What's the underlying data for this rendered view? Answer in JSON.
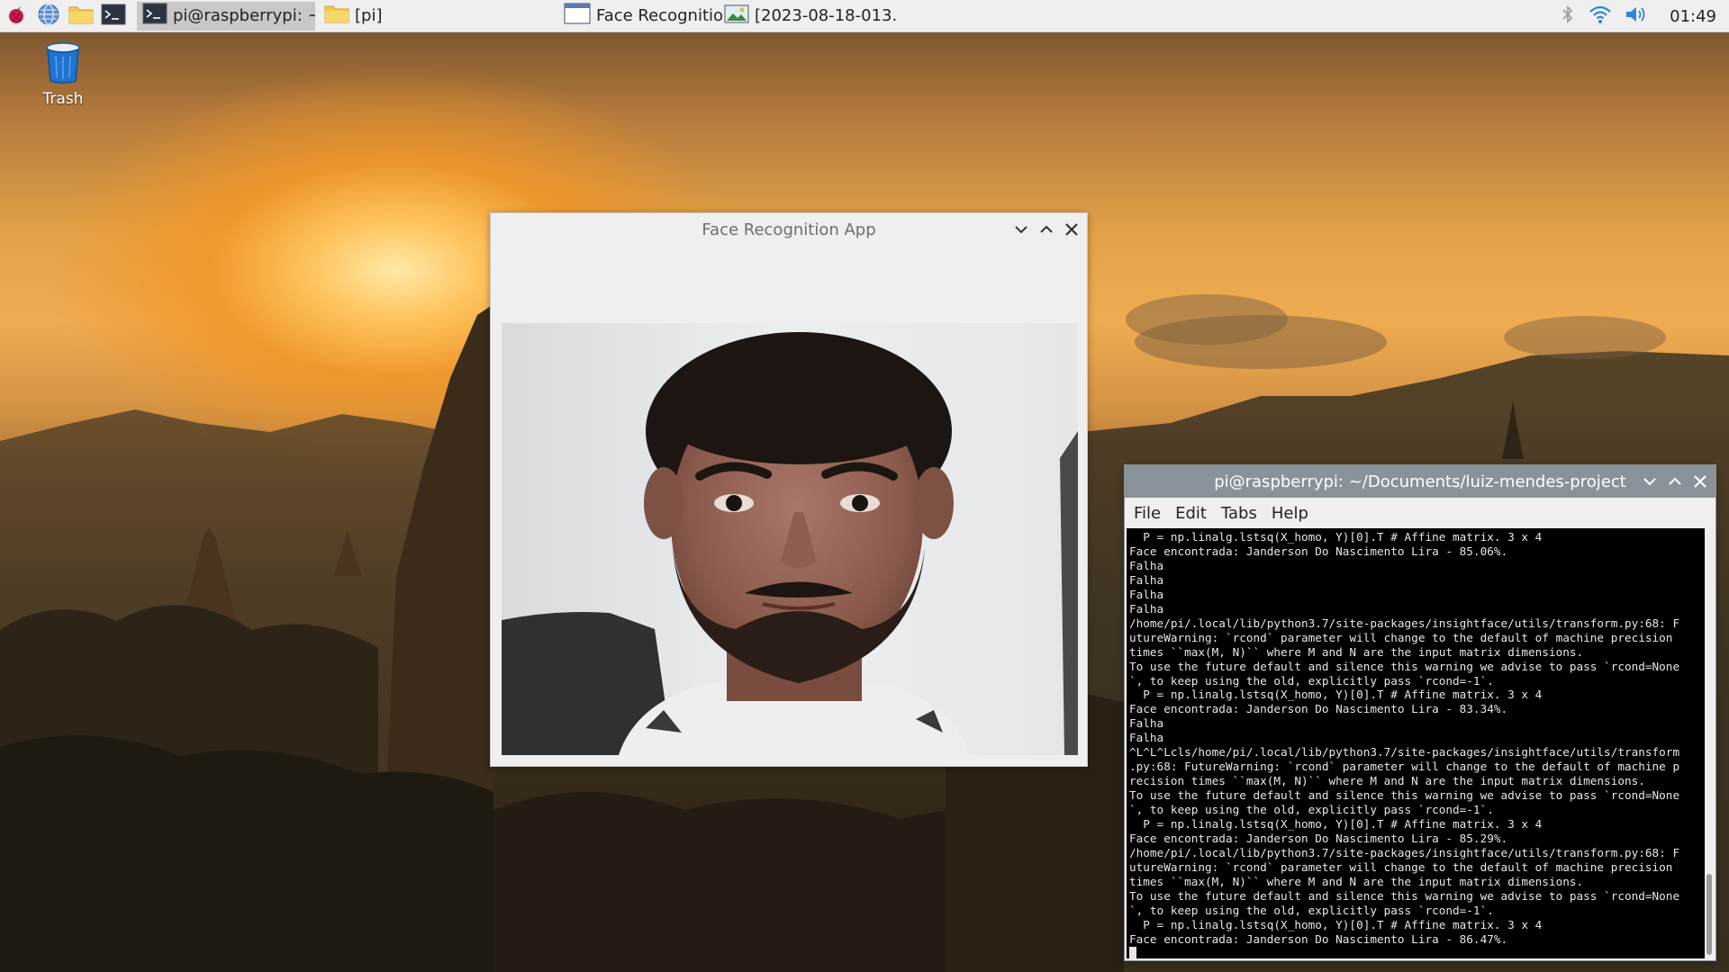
{
  "taskbar": {
    "tasks": [
      {
        "label": "pi@raspberrypi: ~..."
      },
      {
        "label": "[pi]"
      },
      {
        "label": "Face Recognition..."
      },
      {
        "label": "[2023-08-18-013..."
      }
    ],
    "clock": "01:49"
  },
  "desktop": {
    "trash_label": "Trash"
  },
  "face_window": {
    "title": "Face Recognition App"
  },
  "terminal": {
    "title": "pi@raspberrypi: ~/Documents/luiz-mendes-project",
    "menu": [
      "File",
      "Edit",
      "Tabs",
      "Help"
    ],
    "lines": [
      "  P = np.linalg.lstsq(X_homo, Y)[0].T # Affine matrix. 3 x 4",
      "Face encontrada: Janderson Do Nascimento Lira - 85.06%.",
      "Falha",
      "Falha",
      "Falha",
      "Falha",
      "/home/pi/.local/lib/python3.7/site-packages/insightface/utils/transform.py:68: F",
      "utureWarning: `rcond` parameter will change to the default of machine precision",
      "times ``max(M, N)`` where M and N are the input matrix dimensions.",
      "To use the future default and silence this warning we advise to pass `rcond=None",
      "`, to keep using the old, explicitly pass `rcond=-1`.",
      "  P = np.linalg.lstsq(X_homo, Y)[0].T # Affine matrix. 3 x 4",
      "Face encontrada: Janderson Do Nascimento Lira - 83.34%.",
      "Falha",
      "Falha",
      "^L^L^Lcls/home/pi/.local/lib/python3.7/site-packages/insightface/utils/transform",
      ".py:68: FutureWarning: `rcond` parameter will change to the default of machine p",
      "recision times ``max(M, N)`` where M and N are the input matrix dimensions.",
      "To use the future default and silence this warning we advise to pass `rcond=None",
      "`, to keep using the old, explicitly pass `rcond=-1`.",
      "  P = np.linalg.lstsq(X_homo, Y)[0].T # Affine matrix. 3 x 4",
      "Face encontrada: Janderson Do Nascimento Lira - 85.29%.",
      "/home/pi/.local/lib/python3.7/site-packages/insightface/utils/transform.py:68: F",
      "utureWarning: `rcond` parameter will change to the default of machine precision",
      "times ``max(M, N)`` where M and N are the input matrix dimensions.",
      "To use the future default and silence this warning we advise to pass `rcond=None",
      "`, to keep using the old, explicitly pass `rcond=-1`.",
      "  P = np.linalg.lstsq(X_homo, Y)[0].T # Affine matrix. 3 x 4",
      "Face encontrada: Janderson Do Nascimento Lira - 86.47%."
    ]
  },
  "colors": {
    "panel_bg": "#efefef",
    "terminal_title_bg": "#8a9299",
    "terminal_bg": "#000000",
    "terminal_fg": "#e6e6e6"
  }
}
